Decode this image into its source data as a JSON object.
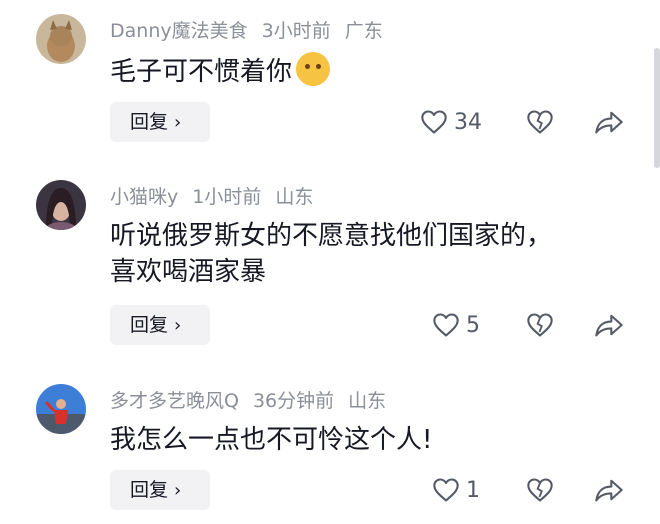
{
  "comments": [
    {
      "username": "Danny魔法美食",
      "time": "3小时前",
      "location": "广东",
      "text_lines": [
        "毛子可不惯着你"
      ],
      "has_emoji": true,
      "reply_label": "回复",
      "likes": "34"
    },
    {
      "username": "小猫咪y",
      "time": "1小时前",
      "location": "山东",
      "text_lines": [
        "听说俄罗斯女的不愿意找他们国家的，",
        "喜欢喝酒家暴"
      ],
      "has_emoji": false,
      "reply_label": "回复",
      "likes": "5"
    },
    {
      "username": "多才多艺晚风Q",
      "time": "36分钟前",
      "location": "山东",
      "text_lines": [
        "我怎么一点也不可怜这个人!"
      ],
      "has_emoji": false,
      "reply_label": "回复",
      "likes": "1"
    }
  ],
  "icons": {
    "like": "heart-outline-icon",
    "dislike": "broken-heart-icon",
    "share": "share-arrow-icon",
    "chevron": "chevron-right-icon"
  },
  "colors": {
    "text": "#161823",
    "meta": "#8a8f99",
    "button_bg": "#f2f2f4"
  }
}
